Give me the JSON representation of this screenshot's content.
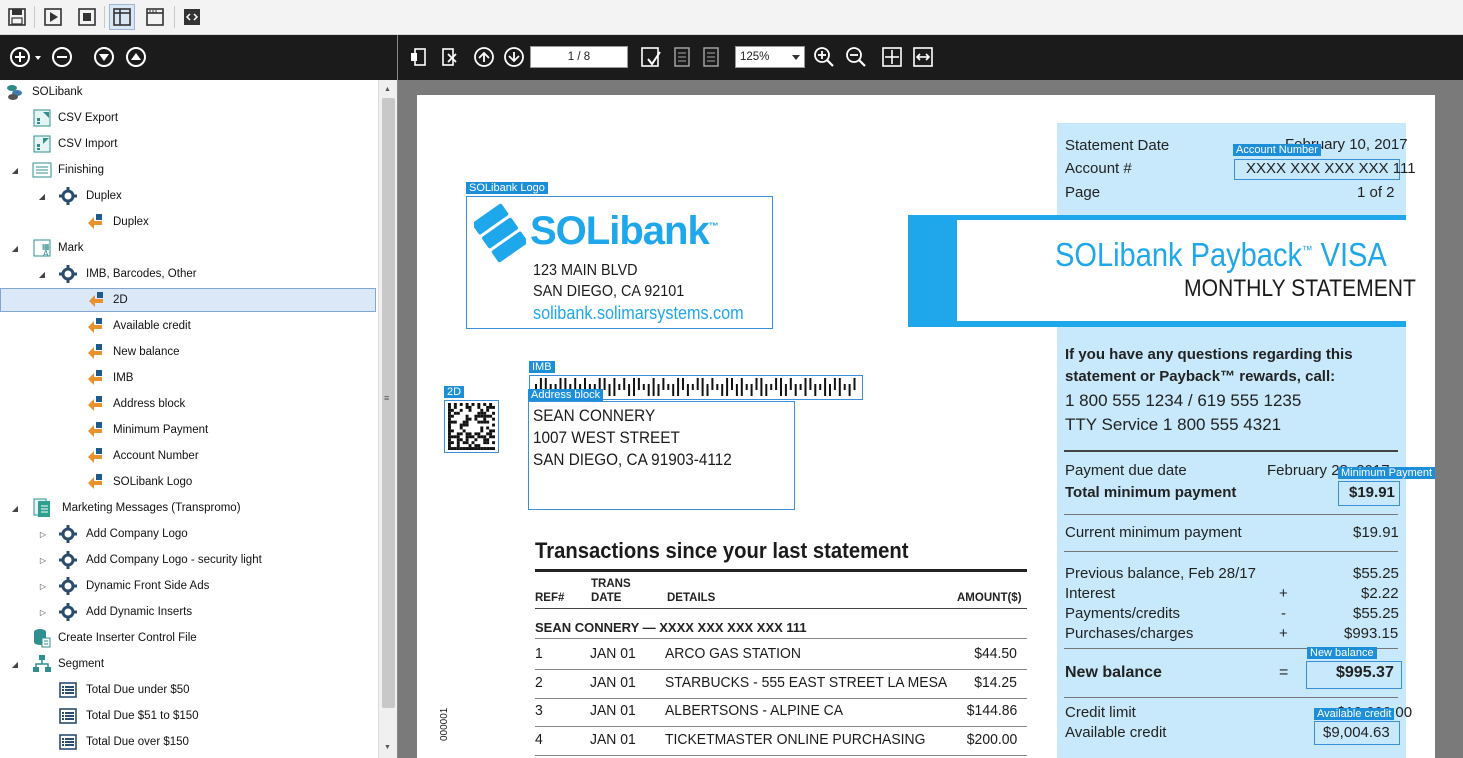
{
  "toolbar": {
    "buttons": [
      "save-icon",
      "play-icon",
      "stop-icon",
      "layout-split-icon",
      "window-icon",
      "code-icon"
    ]
  },
  "tree_toolbar": {
    "buttons": [
      "add-icon",
      "remove-icon",
      "move-down-icon",
      "move-up-icon"
    ]
  },
  "tree": {
    "root": "SOLibank",
    "csv_export": "CSV Export",
    "csv_import": "CSV Import",
    "finishing": "Finishing",
    "duplex_group": "Duplex",
    "duplex_item": "Duplex",
    "mark": "Mark",
    "imb_group": "IMB, Barcodes, Other",
    "mark_items": [
      "2D",
      "Available credit",
      "New balance",
      "IMB",
      "Address block",
      "Minimum Payment",
      "Account Number",
      "SOLibank Logo"
    ],
    "marketing": "Marketing Messages (Transpromo)",
    "marketing_items": [
      "Add Company Logo",
      "Add Company Logo - security light",
      "Dynamic Front Side Ads",
      "Add Dynamic Inserts"
    ],
    "inserter": "Create Inserter Control File",
    "segment": "Segment",
    "segment_items": [
      "Total Due under $50",
      "Total Due $51 to $150",
      "Total Due over $150"
    ]
  },
  "viewer": {
    "page_indicator": "1 / 8",
    "zoom": "125%"
  },
  "doc": {
    "tags": {
      "logo": "SOLibank Logo",
      "imb": "IMB",
      "address": "Address block",
      "twod": "2D",
      "account": "Account Number",
      "minimum": "Minimum Payment",
      "newbal": "New balance",
      "available": "Available credit"
    },
    "logo_text": "SOLibank",
    "logo_tm": "™",
    "bank_address": [
      "123 MAIN BLVD",
      "SAN DIEGO, CA 92101"
    ],
    "website": "solibank.solimarsystems.com",
    "recipient": [
      "SEAN CONNERY",
      "1007 WEST STREET",
      "SAN DIEGO, CA 91903-4112"
    ],
    "statement_date_label": "Statement Date",
    "statement_date_value": "February 10, 2017",
    "account_label": "Account #",
    "account_value": "XXXX XXX XXX XXX 111",
    "page_label": "Page",
    "page_value": "1 of 2",
    "banner_title": "SOLibank Payback",
    "banner_tm": "™",
    "banner_title_end": " VISA",
    "banner_subtitle": "MONTHLY STATEMENT",
    "questions": [
      "If you have any questions regarding this",
      "statement or Payback™ rewards, call:"
    ],
    "phone1": "1 800 555 1234 / 619 555 1235",
    "phone2": "TTY Service 1 800 555 4321",
    "due_date_label": "Payment due date",
    "due_date_value": "February 28, 2017",
    "total_min_label": "Total minimum payment",
    "total_min_value": "$19.91",
    "current_min_label": "Current minimum payment",
    "current_min_value": "$19.91",
    "prev_label": "Previous balance, Feb 28/17",
    "prev_value": "$55.25",
    "interest_label": "Interest",
    "interest_op": "+",
    "interest_value": "$2.22",
    "payments_label": "Payments/credits",
    "payments_op": "-",
    "payments_value": "$55.25",
    "purchases_label": "Purchases/charges",
    "purchases_op": "+",
    "purchases_value": "$993.15",
    "newbal_label": "New balance",
    "newbal_op": "=",
    "newbal_value": "$995.37",
    "credit_limit_label": "Credit limit",
    "credit_limit_value": "$10,000.00",
    "available_label": "Available credit",
    "available_value": "$9,004.63",
    "tx_title": "Transactions since your last statement",
    "tx_headers": {
      "ref": "REF#",
      "trans": "TRANS",
      "date": "DATE",
      "details": "DETAILS",
      "amount": "AMOUNT($)"
    },
    "tx_owner": "SEAN CONNERY — XXXX XXX XXX XXX 111",
    "transactions": [
      {
        "ref": "1",
        "date": "JAN 01",
        "details": "ARCO GAS STATION",
        "amount": "$44.50"
      },
      {
        "ref": "2",
        "date": "JAN 01",
        "details": "STARBUCKS -  555 EAST STREET LA MESA",
        "amount": "$14.25"
      },
      {
        "ref": "3",
        "date": "JAN 01",
        "details": "ALBERTSONS - ALPINE CA",
        "amount": "$144.86"
      },
      {
        "ref": "4",
        "date": "JAN 01",
        "details": "TICKETMASTER ONLINE PURCHASING",
        "amount": "$200.00"
      }
    ],
    "side_code": "000001"
  }
}
